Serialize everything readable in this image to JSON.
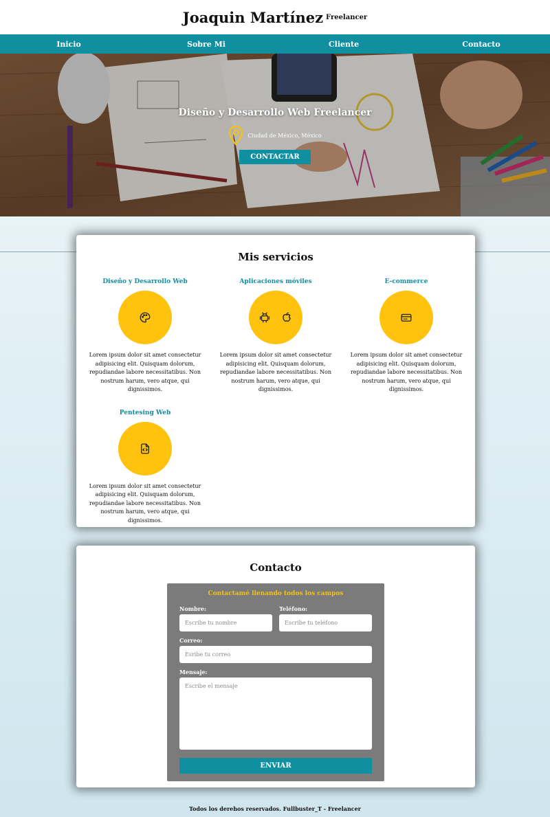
{
  "header": {
    "title": "Joaquin Martínez",
    "subtitle": "Freelancer"
  },
  "nav": {
    "items": [
      {
        "label": "Inicio"
      },
      {
        "label": "Sobre Mi"
      },
      {
        "label": "Cliente"
      },
      {
        "label": "Contacto"
      }
    ]
  },
  "hero": {
    "heading": "Diseño y Desarrollo Web Freelancer",
    "location": "Ciudad de México, México",
    "location_icon": "map-pin-icon",
    "cta_label": "CONTACTAR"
  },
  "services": {
    "title": "Mis servicios",
    "items": [
      {
        "title": "Diseño y Desarrollo Web",
        "icon": "palette-icon",
        "description": "Lorem ipsum dolor sit amet consectetur adipisicing elit. Quisquam dolorum, repudiandae labore necessitatibus. Non nostrum harum, vero atque, qui dignissimos."
      },
      {
        "title": "Aplicaciones móviles",
        "icon": "android-apple-icon",
        "description": "Lorem ipsum dolor sit amet consectetur adipisicing elit. Quisquam dolorum, repudiandae labore necessitatibus. Non nostrum harum, vero atque, qui dignissimos."
      },
      {
        "title": "E-commerce",
        "icon": "credit-card-icon",
        "description": "Lorem ipsum dolor sit amet consectetur adipisicing elit. Quisquam dolorum, repudiandae labore necessitatibus. Non nostrum harum, vero atque, qui dignissimos."
      },
      {
        "title": "Pentesing Web",
        "icon": "code-file-icon",
        "description": "Lorem ipsum dolor sit amet consectetur adipisicing elit. Quisquam dolorum, repudiandae labore necessitatibus. Non nostrum harum, vero atque, qui dignissimos."
      }
    ]
  },
  "contact": {
    "title": "Contacto",
    "form_heading": "Contactamé llenando todos los campos",
    "name_label": "Nombre:",
    "name_placeholder": "Escribe tu nombre",
    "phone_label": "Teléfono:",
    "phone_placeholder": "Escribe tu teléfono",
    "email_label": "Correo:",
    "email_placeholder": "Esribe tu correo",
    "message_label": "Mensaje:",
    "message_placeholder": "Escribe el mensaje",
    "submit_label": "ENVIAR"
  },
  "footer": {
    "text": "Todos los derehos reservados. Fullbuster_T - Freelancer"
  },
  "colors": {
    "accent": "#0f8fa0",
    "yellow": "#ffc20e",
    "form_bg": "#7b7b7b"
  }
}
